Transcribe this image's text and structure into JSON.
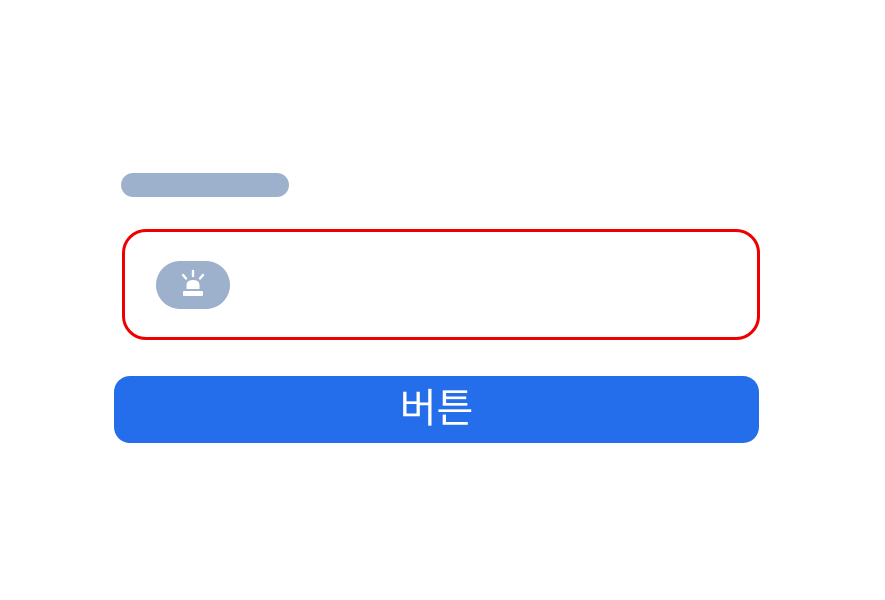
{
  "colors": {
    "placeholder": "#9db1cc",
    "alert_border": "#ee0000",
    "primary_button": "#246deb",
    "button_text": "#ffffff"
  },
  "alert": {
    "icon": "siren-icon"
  },
  "button": {
    "label": "버튼"
  }
}
